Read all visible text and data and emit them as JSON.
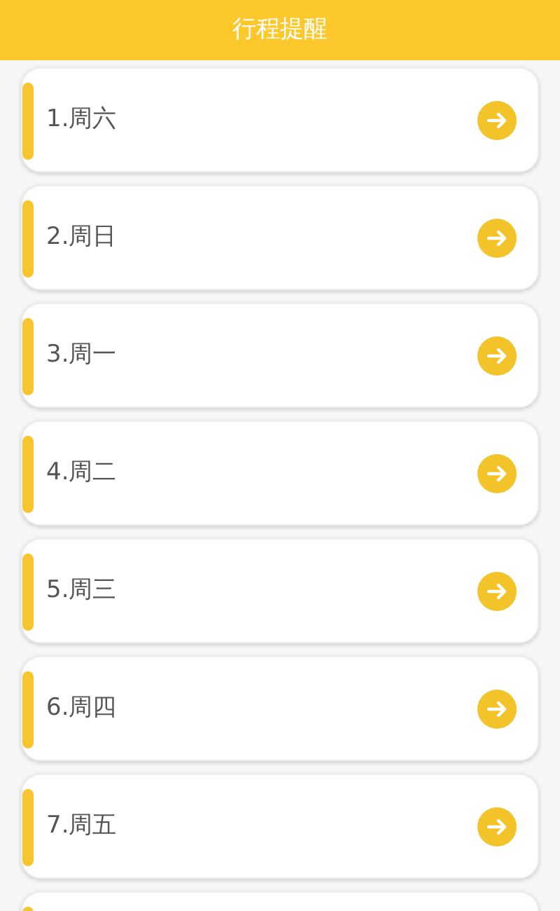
{
  "header": {
    "title": "行程提醒"
  },
  "items": [
    {
      "label": "1.周六"
    },
    {
      "label": "2.周日"
    },
    {
      "label": "3.周一"
    },
    {
      "label": "4.周二"
    },
    {
      "label": "5.周三"
    },
    {
      "label": "6.周四"
    },
    {
      "label": "7.周五"
    }
  ],
  "more_below": true
}
